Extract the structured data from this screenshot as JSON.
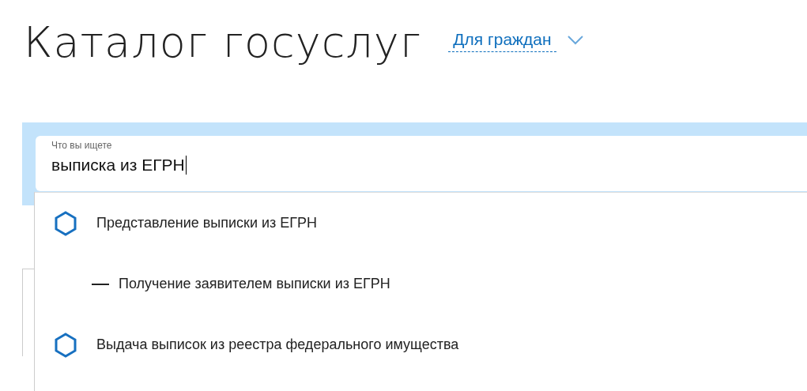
{
  "header": {
    "title": "Каталог госуслуг",
    "audience": "Для граждан"
  },
  "search": {
    "label": "Что вы ищете",
    "value": "выписка из ЕГРН"
  },
  "suggestions": [
    {
      "kind": "service",
      "text": "Представление выписки из ЕГРН"
    },
    {
      "kind": "subservice",
      "text": "Получение заявителем выписки из ЕГРН"
    },
    {
      "kind": "service",
      "text": "Выдача выписок из реестра федерального имущества"
    }
  ]
}
